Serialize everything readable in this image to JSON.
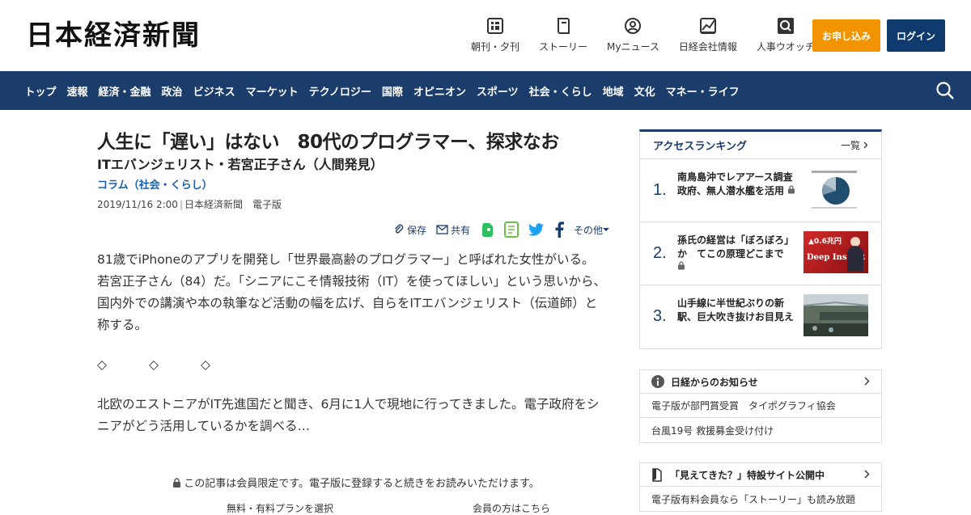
{
  "header": {
    "logo": "日本経済新聞",
    "nav": [
      {
        "label": "朝刊・夕刊",
        "icon": "newspaper-icon"
      },
      {
        "label": "ストーリー",
        "icon": "book-icon"
      },
      {
        "label": "Myニュース",
        "icon": "user-icon"
      },
      {
        "label": "日経会社情報",
        "icon": "chart-icon"
      },
      {
        "label": "人事ウオッチ",
        "icon": "search-icon"
      }
    ],
    "subscribe_label": "お申し込み",
    "login_label": "ログイン"
  },
  "navbar": {
    "items": [
      "トップ",
      "速報",
      "経済・金融",
      "政治",
      "ビジネス",
      "マーケット",
      "テクノロジー",
      "国際",
      "オピニオン",
      "スポーツ",
      "社会・くらし",
      "地域",
      "文化",
      "マネー・ライフ"
    ]
  },
  "article": {
    "title": "人生に「遅い」はない　80代のプログラマー、探求なお",
    "subtitle": "ITエバンジェリスト・若宮正子さん（人間発見）",
    "category": "コラム（社会・くらし）",
    "date": "2019/11/16 2:00",
    "source": "日本経済新聞　電子版",
    "tools": {
      "save": "保存",
      "share": "共有",
      "more": "その他"
    },
    "paragraph1": "81歳でiPhoneのアプリを開発し「世界最高齢のプログラマー」と呼ばれた女性がいる。若宮正子さん（84）だ。「シニアにこそ情報技術（IT）を使ってほしい」という思いから、国内外での講演や本の執筆など活動の幅を広げ、自らをITエバンジェリスト（伝道師）と称する。",
    "diamonds": [
      "◇",
      "◇",
      "◇"
    ],
    "paragraph2": "北欧のエストニアがIT先進国だと聞き、6月に1人で現地に行ってきました。電子政府をシニアがどう活用しているかを調べる…",
    "paywall": "この記事は会員限定です。電子版に登録すると続きをお読みいただけます。",
    "paywall_links": [
      "無料・有料プランを選択",
      "会員の方はこちら"
    ]
  },
  "ranking": {
    "title": "アクセスランキング",
    "more": "一覧",
    "items": [
      {
        "num": "1.",
        "text": "南鳥島沖でレアアース調査　政府、無人潜水艦を活用"
      },
      {
        "num": "2.",
        "text": "孫氏の経営は「ぼろぼろ」か　てこの原理どこまで"
      },
      {
        "num": "3.",
        "text": "山手線に半世紀ぶりの新駅、巨大吹き抜けお目見え"
      }
    ],
    "thumb2_caption": "▲0.6兆円",
    "thumb2_brand": "Deep Insight"
  },
  "notice": {
    "title": "日経からのお知らせ",
    "rows": [
      "電子版が部門賞受賞　タイポグラフィ協会",
      "台風19号 救援募金受け付け"
    ]
  },
  "special": {
    "title": "「見えてきた？」特設サイト公開中",
    "rows": [
      "電子版有料会員なら「ストーリー」も読み放題"
    ]
  },
  "colors": {
    "navy": "#1b3d6c",
    "orange": "#f29400",
    "link": "#1b5eb0"
  }
}
